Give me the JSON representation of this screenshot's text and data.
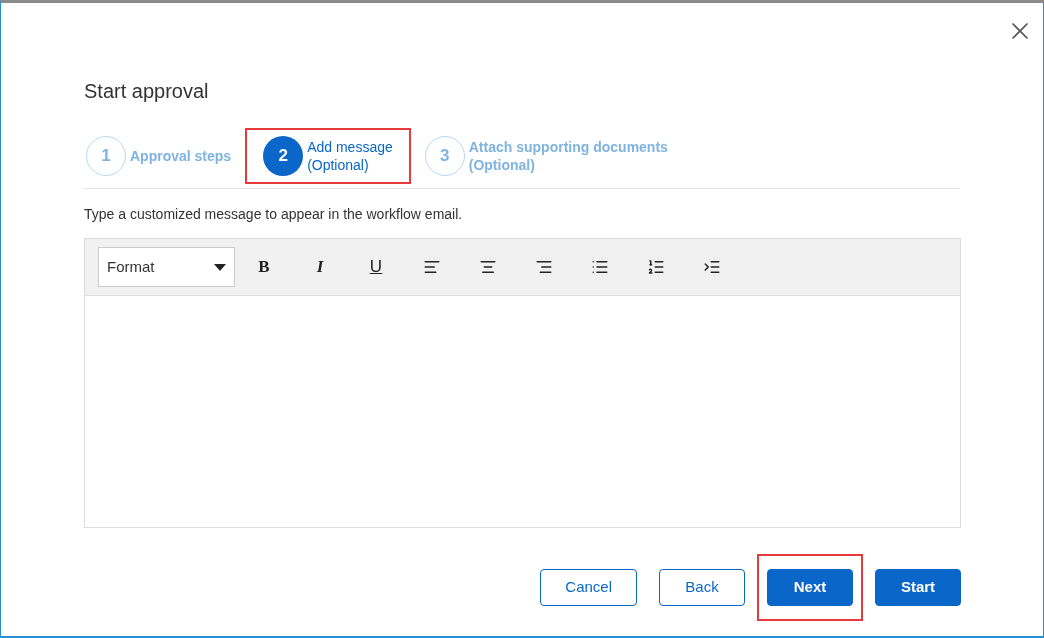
{
  "dialog": {
    "title": "Start approval"
  },
  "steps": [
    {
      "number": "1",
      "label": "Approval steps",
      "selected": false,
      "highlighted": false
    },
    {
      "number": "2",
      "label": "Add message",
      "sublabel": "(Optional)",
      "selected": true,
      "highlighted": true
    },
    {
      "number": "3",
      "label": "Attach supporting documents",
      "sublabel": "(Optional)",
      "selected": false,
      "highlighted": false
    }
  ],
  "instruction": "Type a customized message to appear in the workflow email.",
  "editor": {
    "format_dropdown": "Format",
    "tools": [
      {
        "kind": "bold",
        "label": "B"
      },
      {
        "kind": "italic",
        "label": "I"
      },
      {
        "kind": "underline",
        "label": "U"
      },
      {
        "kind": "align-left"
      },
      {
        "kind": "align-center"
      },
      {
        "kind": "align-right"
      },
      {
        "kind": "bullet-list"
      },
      {
        "kind": "numbered-list"
      },
      {
        "kind": "indent"
      }
    ]
  },
  "buttons": [
    {
      "label": "Cancel",
      "kind": "outline",
      "highlighted": false
    },
    {
      "label": "Back",
      "kind": "outline",
      "highlighted": false
    },
    {
      "label": "Next",
      "kind": "primary",
      "highlighted": true
    },
    {
      "label": "Start",
      "kind": "primary",
      "highlighted": false
    }
  ]
}
